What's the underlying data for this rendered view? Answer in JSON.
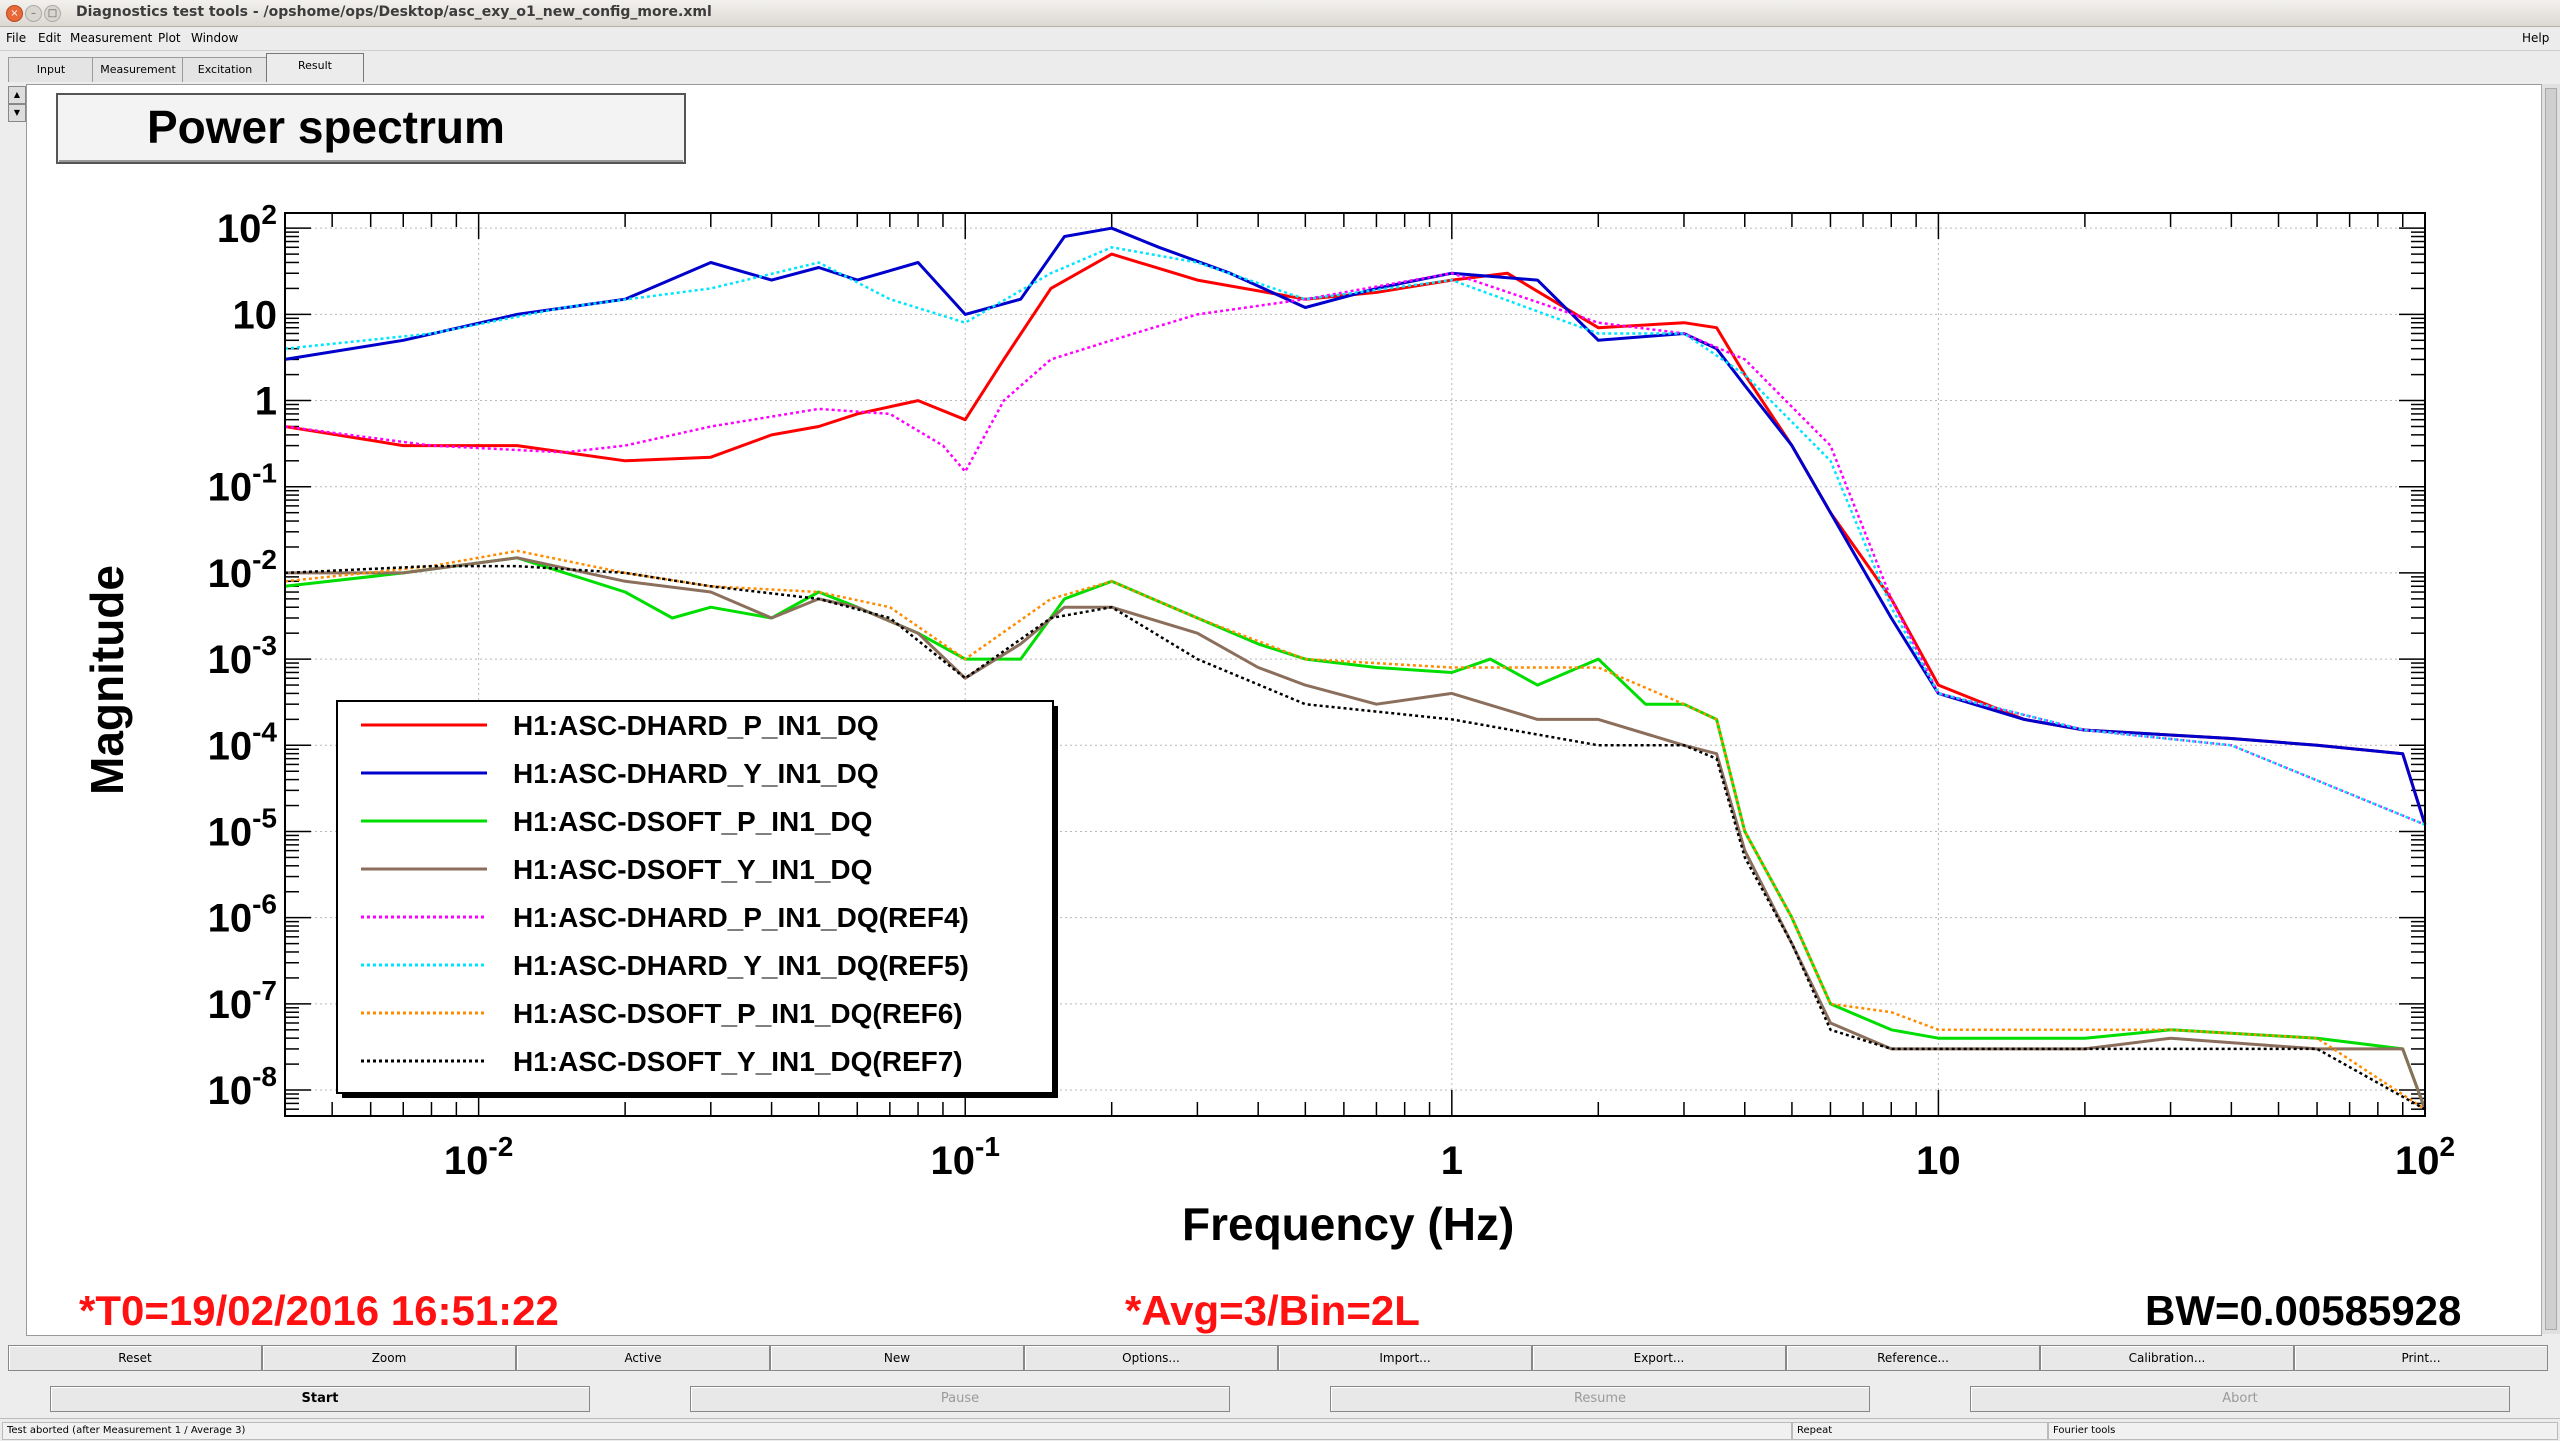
{
  "window": {
    "title": "Diagnostics test tools - /opshome/ops/Desktop/asc_exy_o1_new_config_more.xml",
    "close_glyph": "×",
    "min_glyph": "–",
    "max_glyph": "□"
  },
  "menu": {
    "file": "File",
    "edit": "Edit",
    "measurement": "Measurement",
    "plot": "Plot",
    "window": "Window",
    "help": "Help"
  },
  "tabs": [
    "Input",
    "Measurement",
    "Excitation",
    "Result"
  ],
  "active_tab": "Result",
  "chart_data": {
    "type": "line",
    "title": "Power spectrum",
    "xlabel": "Frequency (Hz)",
    "ylabel": "Magnitude",
    "x_scale": "log",
    "y_scale": "log",
    "xlim": [
      0.004,
      100
    ],
    "ylim": [
      5e-09,
      150
    ],
    "grid": true,
    "legend_position": "bottom-left",
    "x_ticks": [
      0.01,
      0.1,
      1,
      10,
      100
    ],
    "x_tick_labels": [
      {
        "base": "10",
        "exp": "-2"
      },
      {
        "base": "10",
        "exp": "-1"
      },
      {
        "base": "1",
        "exp": ""
      },
      {
        "base": "10",
        "exp": ""
      },
      {
        "base": "10",
        "exp": "2"
      }
    ],
    "y_ticks": [
      1e-08,
      1e-07,
      1e-06,
      1e-05,
      0.0001,
      0.001,
      0.01,
      0.1,
      1,
      10,
      100
    ],
    "y_tick_labels": [
      {
        "base": "10",
        "exp": "-8"
      },
      {
        "base": "10",
        "exp": "-7"
      },
      {
        "base": "10",
        "exp": "-6"
      },
      {
        "base": "10",
        "exp": "-5"
      },
      {
        "base": "10",
        "exp": "-4"
      },
      {
        "base": "10",
        "exp": "-3"
      },
      {
        "base": "10",
        "exp": "-2"
      },
      {
        "base": "10",
        "exp": "-1"
      },
      {
        "base": "1",
        "exp": ""
      },
      {
        "base": "10",
        "exp": ""
      },
      {
        "base": "10",
        "exp": "2"
      }
    ],
    "series": [
      {
        "name": "H1:ASC-DHARD_P_IN1_DQ",
        "color": "#ff0000",
        "dash": "solid",
        "x": [
          0.004,
          0.007,
          0.012,
          0.02,
          0.03,
          0.04,
          0.05,
          0.06,
          0.08,
          0.1,
          0.12,
          0.15,
          0.2,
          0.3,
          0.5,
          0.7,
          1,
          1.3,
          2,
          3,
          3.5,
          4,
          5,
          6,
          8,
          10,
          15,
          20,
          40,
          60,
          90,
          100
        ],
        "y": [
          0.5,
          0.3,
          0.3,
          0.2,
          0.22,
          0.4,
          0.5,
          0.7,
          1,
          0.6,
          3,
          20,
          50,
          25,
          15,
          18,
          25,
          30,
          7,
          8,
          7,
          2,
          0.3,
          0.05,
          0.005,
          0.0005,
          0.0002,
          0.00015,
          0.00012,
          0.0001,
          8e-05,
          1.2e-05
        ]
      },
      {
        "name": "H1:ASC-DHARD_Y_IN1_DQ",
        "color": "#0000cc",
        "dash": "solid",
        "x": [
          0.004,
          0.007,
          0.012,
          0.02,
          0.03,
          0.04,
          0.05,
          0.06,
          0.08,
          0.1,
          0.13,
          0.16,
          0.2,
          0.25,
          0.35,
          0.5,
          0.7,
          1,
          1.5,
          2,
          3,
          3.5,
          4,
          5,
          6,
          8,
          10,
          15,
          20,
          40,
          60,
          90,
          100
        ],
        "y": [
          3,
          5,
          10,
          15,
          40,
          25,
          35,
          25,
          40,
          10,
          15,
          80,
          100,
          60,
          30,
          12,
          20,
          30,
          25,
          5,
          6,
          4,
          1.5,
          0.3,
          0.05,
          0.003,
          0.0004,
          0.0002,
          0.00015,
          0.00012,
          0.0001,
          8e-05,
          1.2e-05
        ]
      },
      {
        "name": "H1:ASC-DSOFT_P_IN1_DQ",
        "color": "#00dd00",
        "dash": "solid",
        "x": [
          0.004,
          0.007,
          0.012,
          0.02,
          0.025,
          0.03,
          0.04,
          0.05,
          0.06,
          0.08,
          0.1,
          0.13,
          0.16,
          0.2,
          0.3,
          0.4,
          0.5,
          0.7,
          1,
          1.2,
          1.5,
          2,
          2.5,
          3,
          3.5,
          4,
          5,
          6,
          8,
          10,
          20,
          30,
          60,
          90,
          100
        ],
        "y": [
          0.007,
          0.01,
          0.015,
          0.006,
          0.003,
          0.004,
          0.003,
          0.006,
          0.004,
          0.002,
          0.001,
          0.001,
          0.005,
          0.008,
          0.003,
          0.0015,
          0.001,
          0.0008,
          0.0007,
          0.001,
          0.0005,
          0.001,
          0.0003,
          0.0003,
          0.0002,
          1e-05,
          1e-06,
          1e-07,
          5e-08,
          4e-08,
          4e-08,
          5e-08,
          4e-08,
          3e-08,
          6e-09
        ]
      },
      {
        "name": "H1:ASC-DSOFT_Y_IN1_DQ",
        "color": "#8b6f5c",
        "dash": "solid",
        "x": [
          0.004,
          0.007,
          0.012,
          0.02,
          0.03,
          0.04,
          0.05,
          0.06,
          0.08,
          0.1,
          0.13,
          0.16,
          0.2,
          0.3,
          0.4,
          0.5,
          0.7,
          1,
          1.5,
          2,
          3,
          3.5,
          4,
          5,
          6,
          8,
          10,
          20,
          30,
          60,
          90,
          100
        ],
        "y": [
          0.01,
          0.01,
          0.015,
          0.008,
          0.006,
          0.003,
          0.005,
          0.004,
          0.002,
          0.0006,
          0.0015,
          0.004,
          0.004,
          0.002,
          0.0008,
          0.0005,
          0.0003,
          0.0004,
          0.0002,
          0.0002,
          0.0001,
          8e-05,
          6e-06,
          5e-07,
          6e-08,
          3e-08,
          3e-08,
          3e-08,
          4e-08,
          3e-08,
          3e-08,
          6e-09
        ]
      },
      {
        "name": "H1:ASC-DHARD_P_IN1_DQ(REF4)",
        "color": "#ff00ff",
        "dash": "dotted",
        "x": [
          0.004,
          0.008,
          0.015,
          0.02,
          0.03,
          0.05,
          0.07,
          0.09,
          0.1,
          0.12,
          0.15,
          0.2,
          0.3,
          0.5,
          1,
          2,
          3,
          4,
          6,
          8,
          10,
          20,
          40,
          100
        ],
        "y": [
          0.5,
          0.3,
          0.25,
          0.3,
          0.5,
          0.8,
          0.7,
          0.3,
          0.15,
          1,
          3,
          5,
          10,
          15,
          30,
          8,
          6,
          3,
          0.3,
          0.005,
          0.0004,
          0.00015,
          0.0001,
          1.2e-05
        ]
      },
      {
        "name": "H1:ASC-DHARD_Y_IN1_DQ(REF5)",
        "color": "#00e5ff",
        "dash": "dotted",
        "x": [
          0.004,
          0.008,
          0.015,
          0.03,
          0.05,
          0.07,
          0.1,
          0.15,
          0.2,
          0.3,
          0.5,
          1,
          2,
          3,
          4,
          6,
          8,
          10,
          20,
          40,
          100
        ],
        "y": [
          4,
          6,
          12,
          20,
          40,
          15,
          8,
          30,
          60,
          40,
          15,
          25,
          6,
          6,
          2,
          0.2,
          0.004,
          0.0004,
          0.00015,
          0.0001,
          1.2e-05
        ]
      },
      {
        "name": "H1:ASC-DSOFT_P_IN1_DQ(REF6)",
        "color": "#ff8c00",
        "dash": "dotted",
        "x": [
          0.004,
          0.008,
          0.012,
          0.02,
          0.03,
          0.05,
          0.07,
          0.1,
          0.15,
          0.2,
          0.3,
          0.5,
          1,
          2,
          3,
          3.5,
          4,
          5,
          6,
          8,
          10,
          30,
          60,
          100
        ],
        "y": [
          0.008,
          0.012,
          0.018,
          0.01,
          0.007,
          0.006,
          0.004,
          0.001,
          0.005,
          0.008,
          0.003,
          0.001,
          0.0008,
          0.0008,
          0.0003,
          0.0002,
          1e-05,
          1e-06,
          1e-07,
          8e-08,
          5e-08,
          5e-08,
          4e-08,
          6e-09
        ]
      },
      {
        "name": "H1:ASC-DSOFT_Y_IN1_DQ(REF7)",
        "color": "#000000",
        "dash": "dotted",
        "x": [
          0.004,
          0.008,
          0.012,
          0.02,
          0.03,
          0.05,
          0.07,
          0.1,
          0.15,
          0.2,
          0.3,
          0.5,
          1,
          2,
          3,
          3.5,
          4,
          5,
          6,
          8,
          10,
          30,
          60,
          100
        ],
        "y": [
          0.01,
          0.012,
          0.012,
          0.01,
          0.007,
          0.005,
          0.003,
          0.0006,
          0.003,
          0.004,
          0.001,
          0.0003,
          0.0002,
          0.0001,
          0.0001,
          7e-05,
          5e-06,
          5e-07,
          5e-08,
          3e-08,
          3e-08,
          3e-08,
          3e-08,
          6e-09
        ]
      }
    ]
  },
  "footer": {
    "t0": "*T0=19/02/2016 16:51:22",
    "avg": "*Avg=3/Bin=2L",
    "bw": "BW=0.00585928"
  },
  "buttons_row1": [
    "Reset",
    "Zoom",
    "Active",
    "New",
    "Options...",
    "Import...",
    "Export...",
    "Reference...",
    "Calibration...",
    "Print..."
  ],
  "buttons_row2": [
    {
      "label": "Start",
      "enabled": true
    },
    {
      "label": "Pause",
      "enabled": false
    },
    {
      "label": "Resume",
      "enabled": false
    },
    {
      "label": "Abort",
      "enabled": false
    }
  ],
  "status": {
    "message": "Test aborted (after Measurement 1 / Average 3)",
    "mode": "Repeat",
    "tool": "Fourier tools"
  }
}
